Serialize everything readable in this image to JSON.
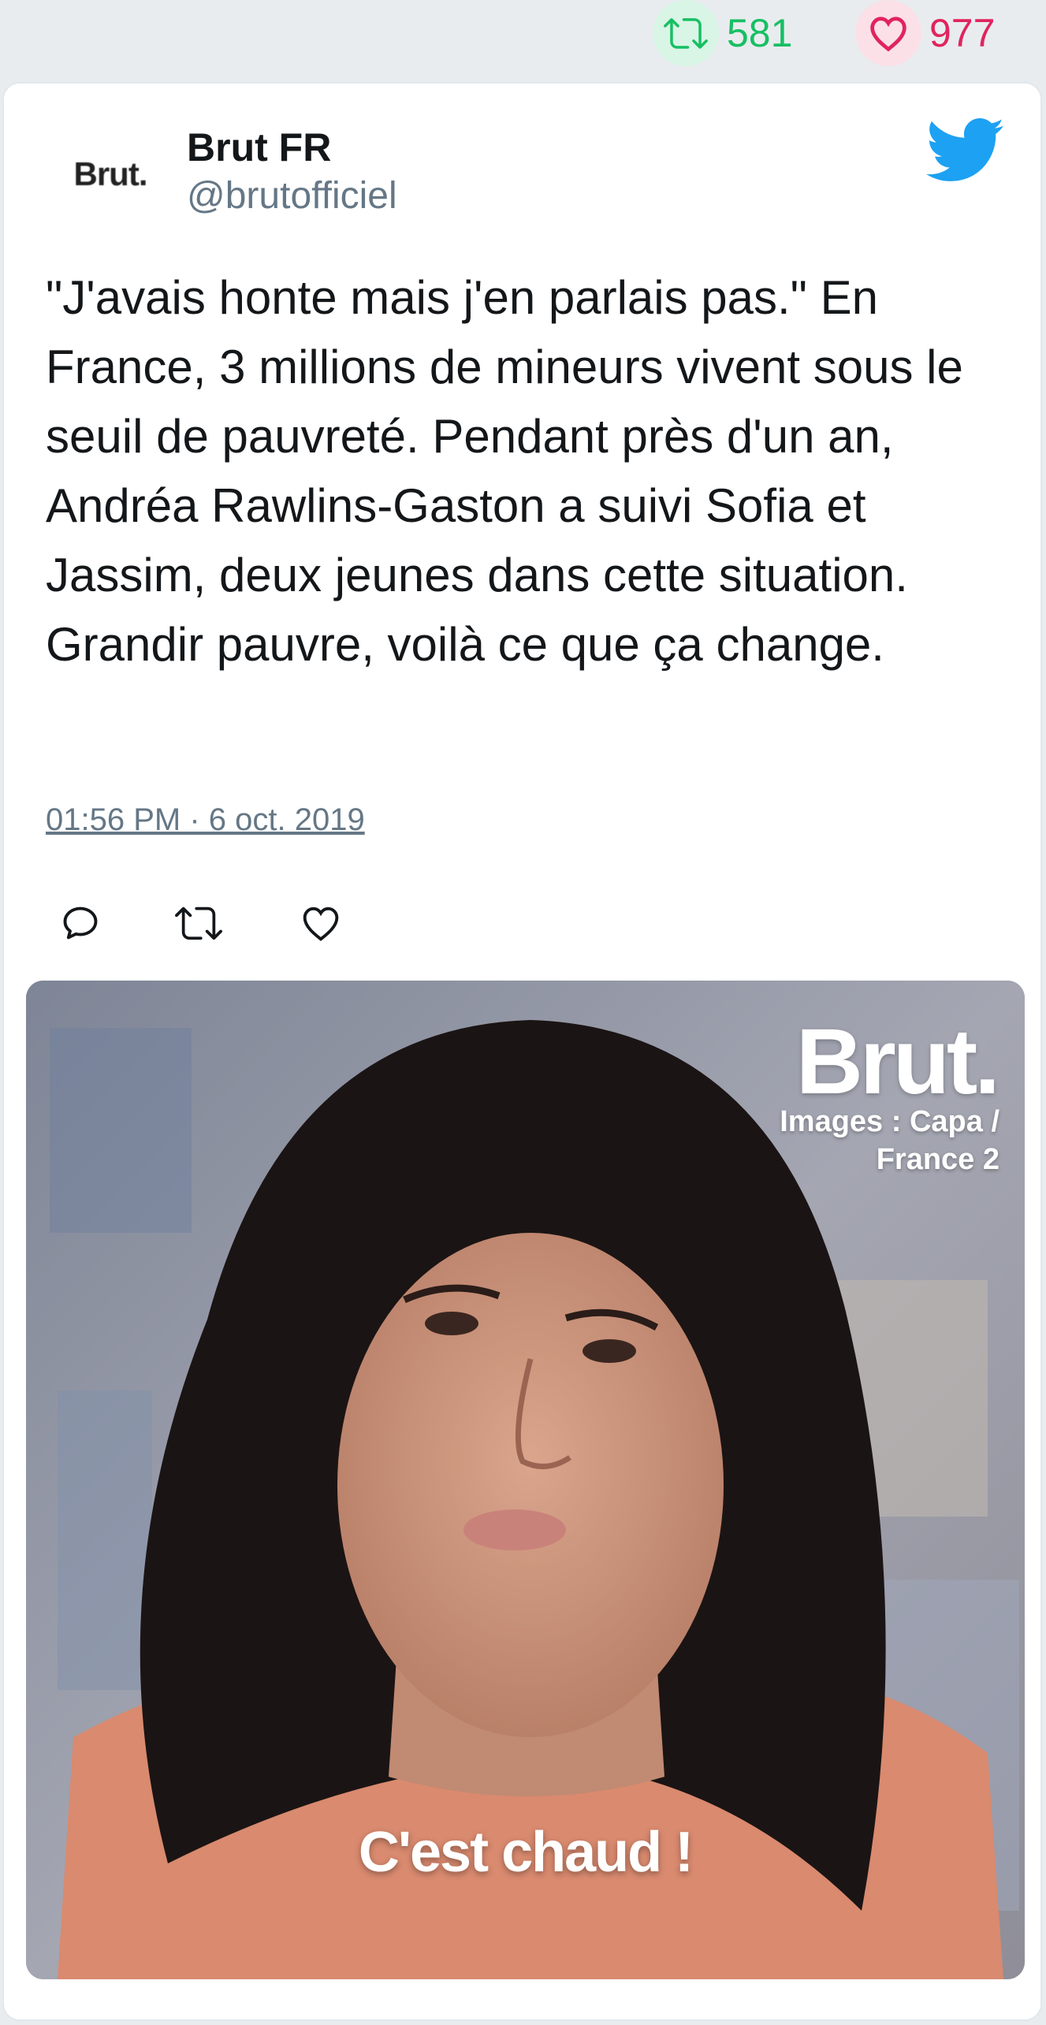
{
  "stats": {
    "retweet_count": "581",
    "like_count": "977",
    "retweet_icon": "retweet-icon",
    "like_icon": "heart-icon",
    "retweet_color": "#17bf63",
    "like_color": "#e0245e"
  },
  "tweet": {
    "avatar_text": "Brut.",
    "display_name": "Brut FR",
    "handle": "@brutofficiel",
    "brand_icon": "twitter-bird-icon",
    "brand_color": "#1da1f2",
    "text": "\"J'avais honte mais j'en parlais pas.\" En France, 3 millions de mineurs vivent sous le seuil de pauvreté. Pendant près d'un an, Andréa Rawlins-Gaston a suivi Sofia et Jassim, deux jeunes dans cette situation. Grandir pauvre, voilà ce que ça change.",
    "timestamp": "01:56 PM · 6 oct. 2019",
    "actions": {
      "reply_icon": "reply-icon",
      "retweet_icon": "retweet-icon",
      "like_icon": "heart-icon"
    }
  },
  "media": {
    "logo_text": "Brut.",
    "credit_line1": "Images : Capa /",
    "credit_line2": "France 2",
    "caption": "C'est chaud !"
  }
}
